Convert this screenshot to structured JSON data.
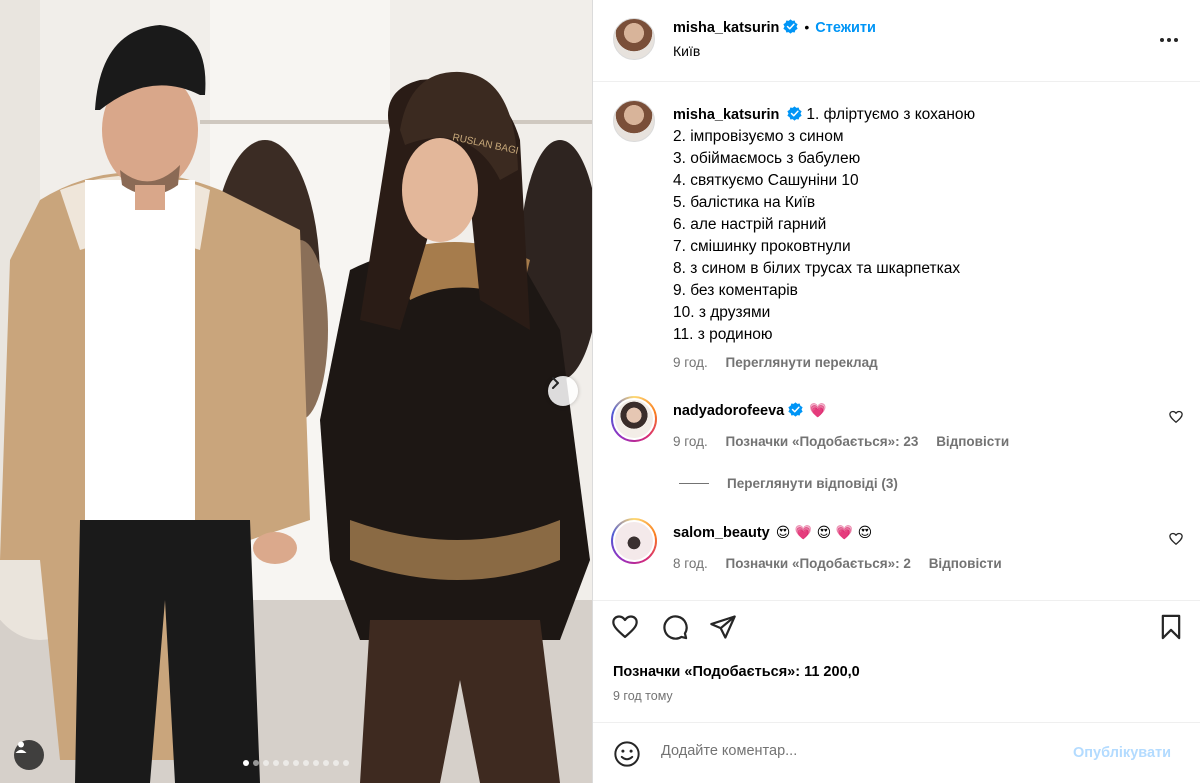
{
  "post": {
    "author": "misha_katsurin",
    "follow_label": "Стежити",
    "separator": "•",
    "location": "Київ"
  },
  "caption": {
    "author": "misha_katsurin",
    "lines": [
      "1. фліртуємо з коханою",
      "2. імпровізуємо з сином",
      "3. обіймаємось з бабулею",
      "4. святкуємо Сашуніни 10",
      "5. балістика на Київ",
      "6. але настрій гарний",
      "7. смішинку проковтнули",
      "8. з сином в білих трусах та шкарпетках",
      "9. без коментарів",
      "10. з друзями",
      "11. з родиною"
    ],
    "time": "9 год.",
    "translate_label": "Переглянути переклад"
  },
  "comments": [
    {
      "user": "nadyadorofeeva",
      "verified": true,
      "text": "💗",
      "time": "9 год.",
      "likes_label": "Позначки «Подобається»: 23",
      "reply_label": "Відповісти"
    },
    {
      "user": "salom_beauty",
      "verified": false,
      "text": "😍 💗 😍 💗 😍",
      "time": "8 год.",
      "likes_label": "Позначки «Подобається»: 2",
      "reply_label": "Відповісти"
    }
  ],
  "view_replies_label": "Переглянути відповіді (3)",
  "likes_summary": "Позначки «Подобається»: 11 200,0",
  "posted_time": "9 год тому",
  "comment_input": {
    "placeholder": "Додайте коментар...",
    "post_label": "Опублікувати"
  },
  "carousel": {
    "total_slides": 11,
    "active_slide": 1
  },
  "colors": {
    "link": "#0095f6",
    "muted": "#737373",
    "post_disabled": "#b3dbff",
    "verified": "#0095f6",
    "heart": "#ff3040"
  },
  "icons": [
    "more-icon",
    "verified-icon",
    "heart-icon",
    "comment-icon",
    "share-icon",
    "bookmark-icon",
    "emoji-icon",
    "chevron-right-icon",
    "user-tag-icon"
  ]
}
